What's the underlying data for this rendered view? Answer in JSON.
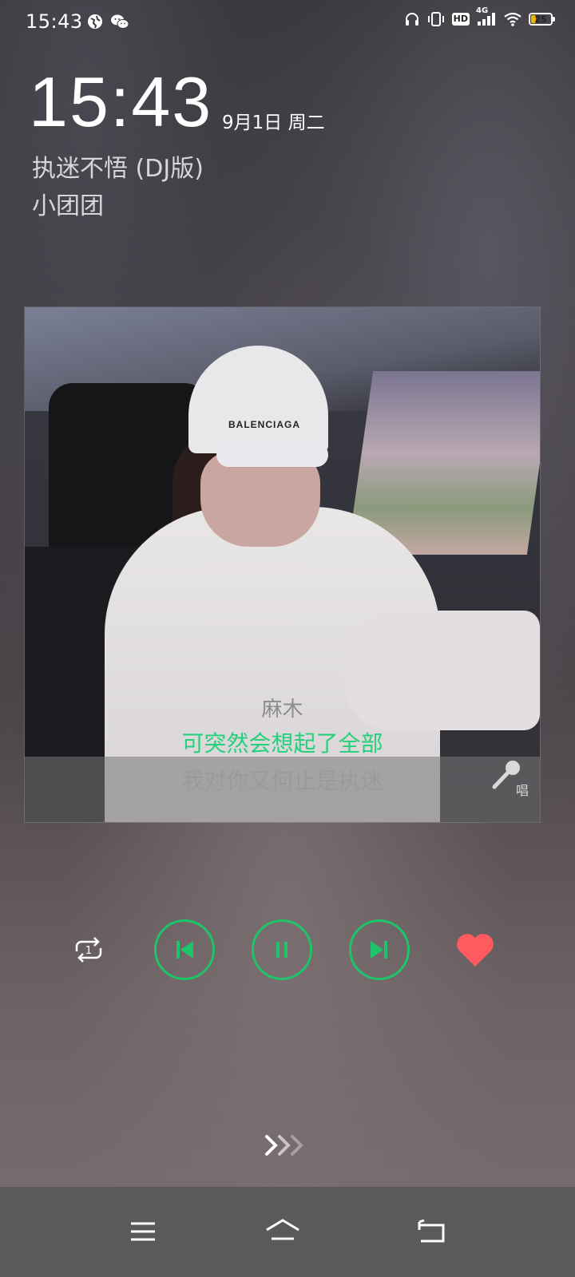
{
  "status_bar": {
    "time": "15:43",
    "left_icons": [
      "globe-icon",
      "wechat-icon"
    ],
    "right_icons": [
      "headphones-icon",
      "vibrate-icon",
      "hd-icon",
      "signal-4g-icon",
      "wifi-icon",
      "battery-icon"
    ],
    "hd_label": "HD",
    "network_label": "4G",
    "battery_percent": "25",
    "battery_level": 0.25,
    "battery_color": "#f1b500"
  },
  "lockscreen": {
    "clock": "15:43",
    "date": "9月1日 周二"
  },
  "now_playing": {
    "song_title": "执迷不悟 (DJ版)",
    "artist": "小团团",
    "cover_brand_text": "BALENCIAGA",
    "lyrics": {
      "previous": "麻木",
      "current": "可突然会想起了全部",
      "next": "我对你又何止是执迷"
    },
    "sing_label": "唱"
  },
  "controls": {
    "repeat_icon": "repeat-one-icon",
    "repeat_count": "1",
    "prev_icon": "skip-previous-icon",
    "pause_icon": "pause-icon",
    "next_icon": "skip-next-icon",
    "favorite_icon": "heart-icon",
    "accent_color": "#1fc46a",
    "favorite_color": "#ff5a5f"
  },
  "swipe_hint_icon": "chevron-right-icon",
  "nav_bar": {
    "menu_icon": "menu-icon",
    "home_icon": "home-icon",
    "back_icon": "back-icon"
  }
}
